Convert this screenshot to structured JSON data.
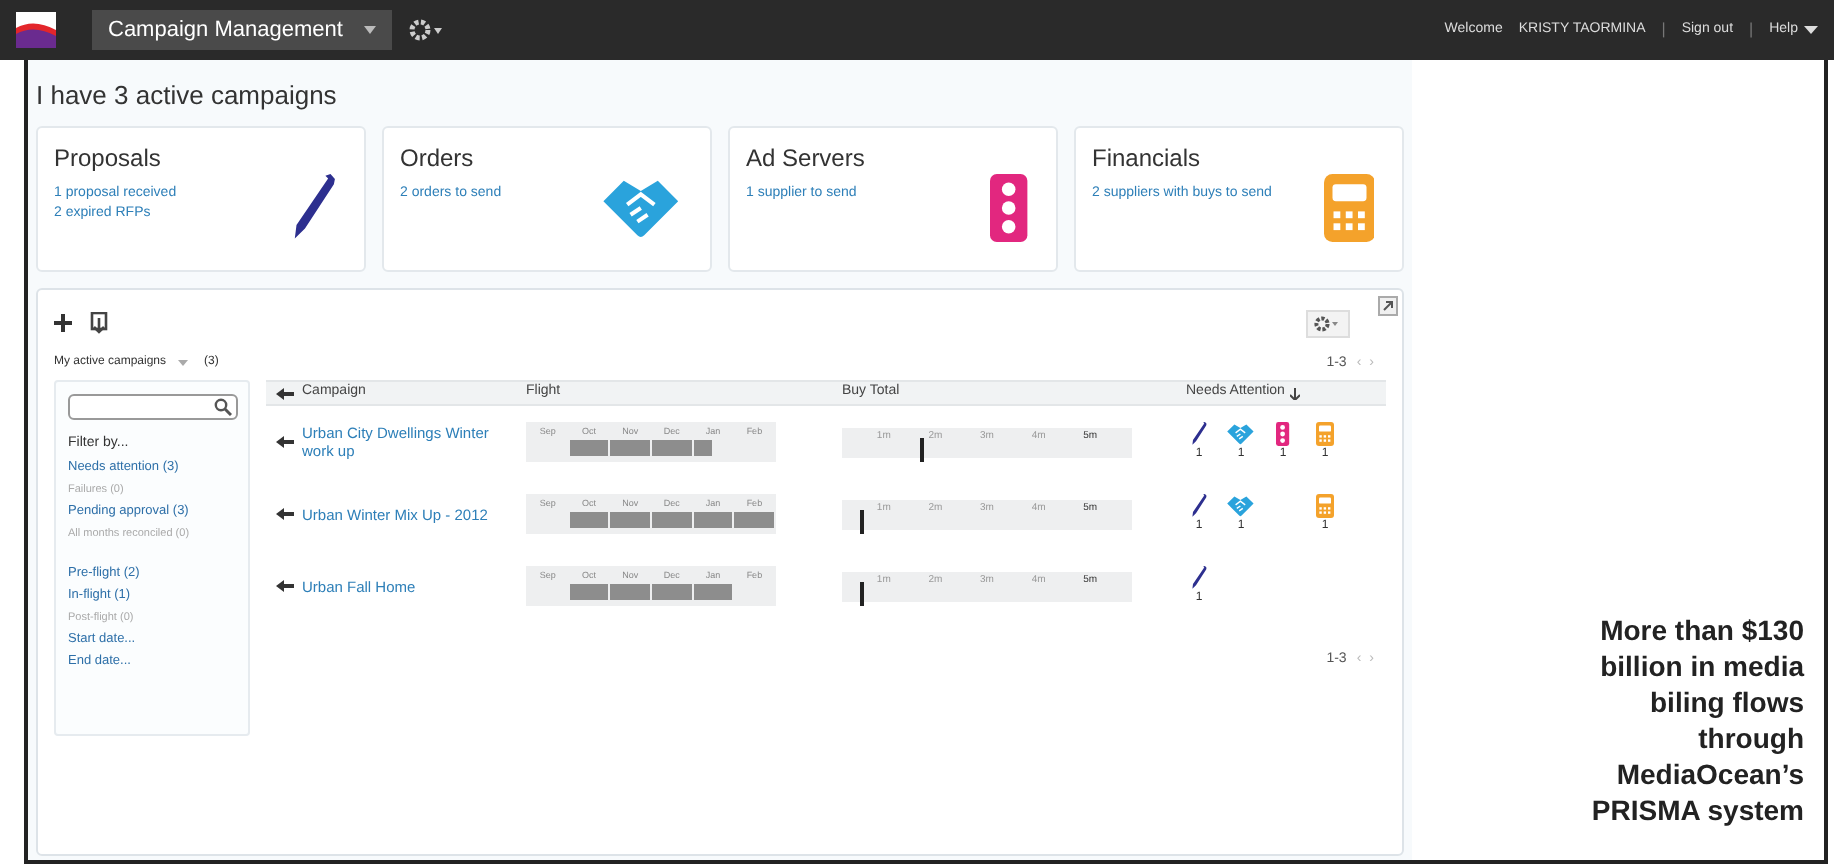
{
  "header": {
    "app_menu": "Campaign Management",
    "welcome": "Welcome",
    "user": "KRISTY TAORMINA",
    "sign_out": "Sign out",
    "help": "Help",
    "separators": [
      "|",
      "|"
    ]
  },
  "page_title": "I have 3 active campaigns",
  "cards": [
    {
      "kind": "pen",
      "title": "Proposals",
      "links": [
        "1 proposal received",
        "2 expired RFPs"
      ]
    },
    {
      "kind": "handshake",
      "title": "Orders",
      "links": [
        "2 orders to send"
      ]
    },
    {
      "kind": "traffic",
      "title": "Ad Servers",
      "links": [
        "1 supplier to send"
      ]
    },
    {
      "kind": "calculator",
      "title": "Financials",
      "links": [
        "2 suppliers with buys to send"
      ]
    }
  ],
  "panel": {
    "view_menu": "My active campaigns",
    "view_count": "(3)",
    "pagination_top": "1-3",
    "pagination_bottom": "1-3",
    "prev": "‹",
    "next": "›",
    "filter_heading": "Filter by...",
    "filter_groups": [
      [
        {
          "label": "Needs attention (3)",
          "disabled": false
        },
        {
          "label": "Failures (0)",
          "disabled": true
        },
        {
          "label": "Pending approval (3)",
          "disabled": false
        },
        {
          "label": "All months reconciled (0)",
          "disabled": true
        }
      ],
      [
        {
          "label": "Pre-flight (2)",
          "disabled": false
        },
        {
          "label": "In-flight (1)",
          "disabled": false
        },
        {
          "label": "Post-flight (0)",
          "disabled": true
        },
        {
          "label": "Start date...",
          "disabled": false
        },
        {
          "label": "End date...",
          "disabled": false
        }
      ]
    ],
    "columns": [
      "Campaign",
      "Flight",
      "Buy Total",
      "Needs Attention"
    ],
    "rows": [
      {
        "campaign": "Urban City Dwellings Winter work up",
        "flight": [
          {
            "month": "Sep",
            "kind": "none"
          },
          {
            "month": "Oct",
            "kind": "full"
          },
          {
            "month": "Nov",
            "kind": "full"
          },
          {
            "month": "Dec",
            "kind": "full"
          },
          {
            "month": "Jan",
            "kind": "partial"
          },
          {
            "month": "Feb",
            "kind": "none"
          }
        ],
        "buy_total": {
          "scale": [
            "1m",
            "2m",
            "3m",
            "4m",
            "5m"
          ],
          "level": 0.27
        },
        "attention": [
          {
            "kind": "pen",
            "count": "1"
          },
          {
            "kind": "handshake",
            "count": "1"
          },
          {
            "kind": "traffic",
            "count": "1"
          },
          {
            "kind": "calculator",
            "count": "1"
          }
        ]
      },
      {
        "campaign": "Urban Winter Mix Up - 2012",
        "flight": [
          {
            "month": "Sep",
            "kind": "none"
          },
          {
            "month": "Oct",
            "kind": "full"
          },
          {
            "month": "Nov",
            "kind": "full"
          },
          {
            "month": "Dec",
            "kind": "full"
          },
          {
            "month": "Jan",
            "kind": "full"
          },
          {
            "month": "Feb",
            "kind": "full"
          }
        ],
        "buy_total": {
          "scale": [
            "1m",
            "2m",
            "3m",
            "4m",
            "5m"
          ],
          "level": 0.06
        },
        "attention": [
          {
            "kind": "pen",
            "count": "1"
          },
          {
            "kind": "handshake",
            "count": "1"
          },
          {
            "kind": "calculator",
            "count": "1"
          }
        ]
      },
      {
        "campaign": "Urban Fall Home",
        "flight": [
          {
            "month": "Sep",
            "kind": "none"
          },
          {
            "month": "Oct",
            "kind": "full"
          },
          {
            "month": "Nov",
            "kind": "full"
          },
          {
            "month": "Dec",
            "kind": "full"
          },
          {
            "month": "Jan",
            "kind": "full"
          },
          {
            "month": "Feb",
            "kind": "none"
          }
        ],
        "buy_total": {
          "scale": [
            "1m",
            "2m",
            "3m",
            "4m",
            "5m"
          ],
          "level": 0.06
        },
        "attention": [
          {
            "kind": "pen",
            "count": "1"
          }
        ]
      }
    ]
  },
  "caption": "More than $130 billion in media biling flows through MediaOcean’s PRISMA system"
}
